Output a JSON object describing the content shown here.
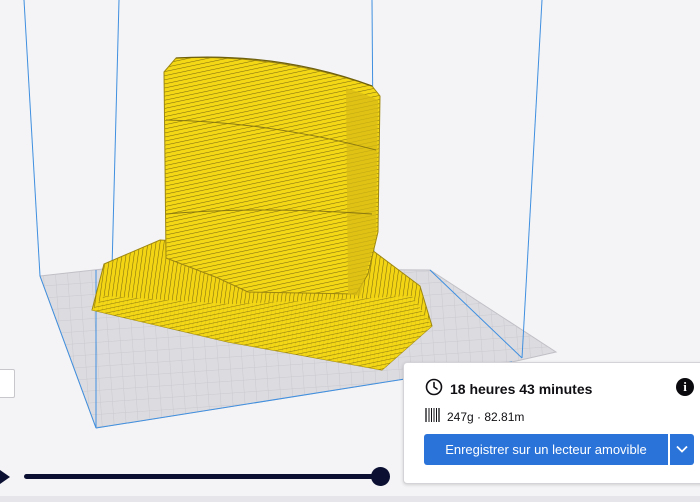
{
  "estimate": {
    "time": "18 heures 43 minutes",
    "material": "247g · 82.81m"
  },
  "actions": {
    "save_label": "Enregistrer sur un lecteur amovible"
  },
  "icons": {
    "time": "clock-icon",
    "info": "info-icon",
    "material": "spool-icon",
    "dropdown": "chevron-down-icon",
    "play": "play-icon"
  },
  "colors": {
    "accent": "#2a73d9",
    "model": "#f5d40f",
    "build_volume_lines": "#3f8fe0",
    "slider": "#0b1033"
  }
}
